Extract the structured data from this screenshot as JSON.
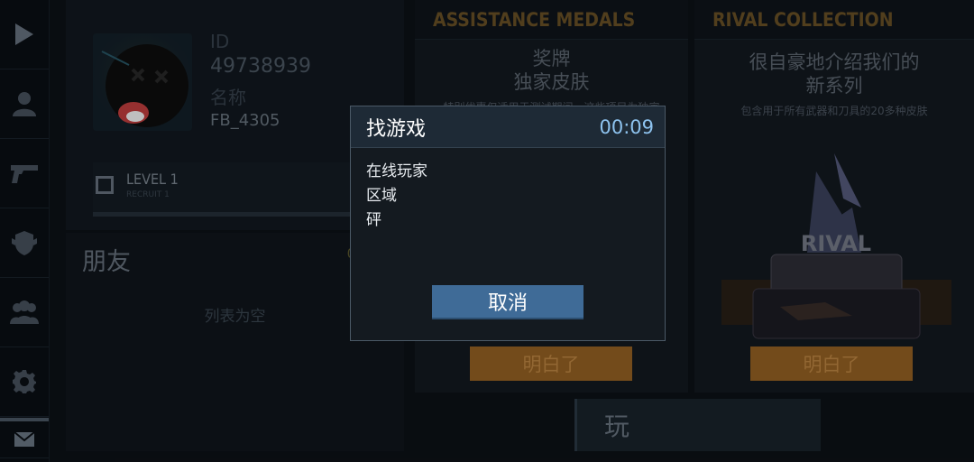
{
  "profile": {
    "id_label": "ID",
    "id_value": "49738939",
    "name_label": "名称",
    "name_value": "FB_4305",
    "level": "LEVEL 1",
    "rank": "RECRUIT 1",
    "xp": "0"
  },
  "friends": {
    "title": "朋友",
    "count": "0 /",
    "empty_text": "列表为空"
  },
  "cards": [
    {
      "header": "ASSISTANCE MEDALS",
      "title_line1": "奖牌",
      "title_line2": "独家皮肤",
      "subtitle": "特别优惠仅适用于测试期间，这些项目为独家",
      "button": "明白了"
    },
    {
      "header": "RIVAL COLLECTION",
      "title_line1": "很自豪地介绍我们的",
      "title_line2": "新系列",
      "subtitle": "包含用于所有武器和刀具的20多种皮肤",
      "logo_text": "RIVAL",
      "button": "明白了"
    }
  ],
  "play_button": "玩",
  "dialog": {
    "title": "找游戏",
    "timer": "00:09",
    "lines": [
      "在线玩家",
      "区域",
      "砰"
    ],
    "cancel": "取消"
  },
  "sidebar": [
    "play-icon",
    "profile-icon",
    "weapon-icon",
    "clan-icon",
    "friends-icon",
    "settings-icon",
    "mail-icon"
  ],
  "colors": {
    "accent_orange": "#9a6424",
    "dialog_button": "#3f6b97",
    "timer": "#8ec3ef"
  }
}
